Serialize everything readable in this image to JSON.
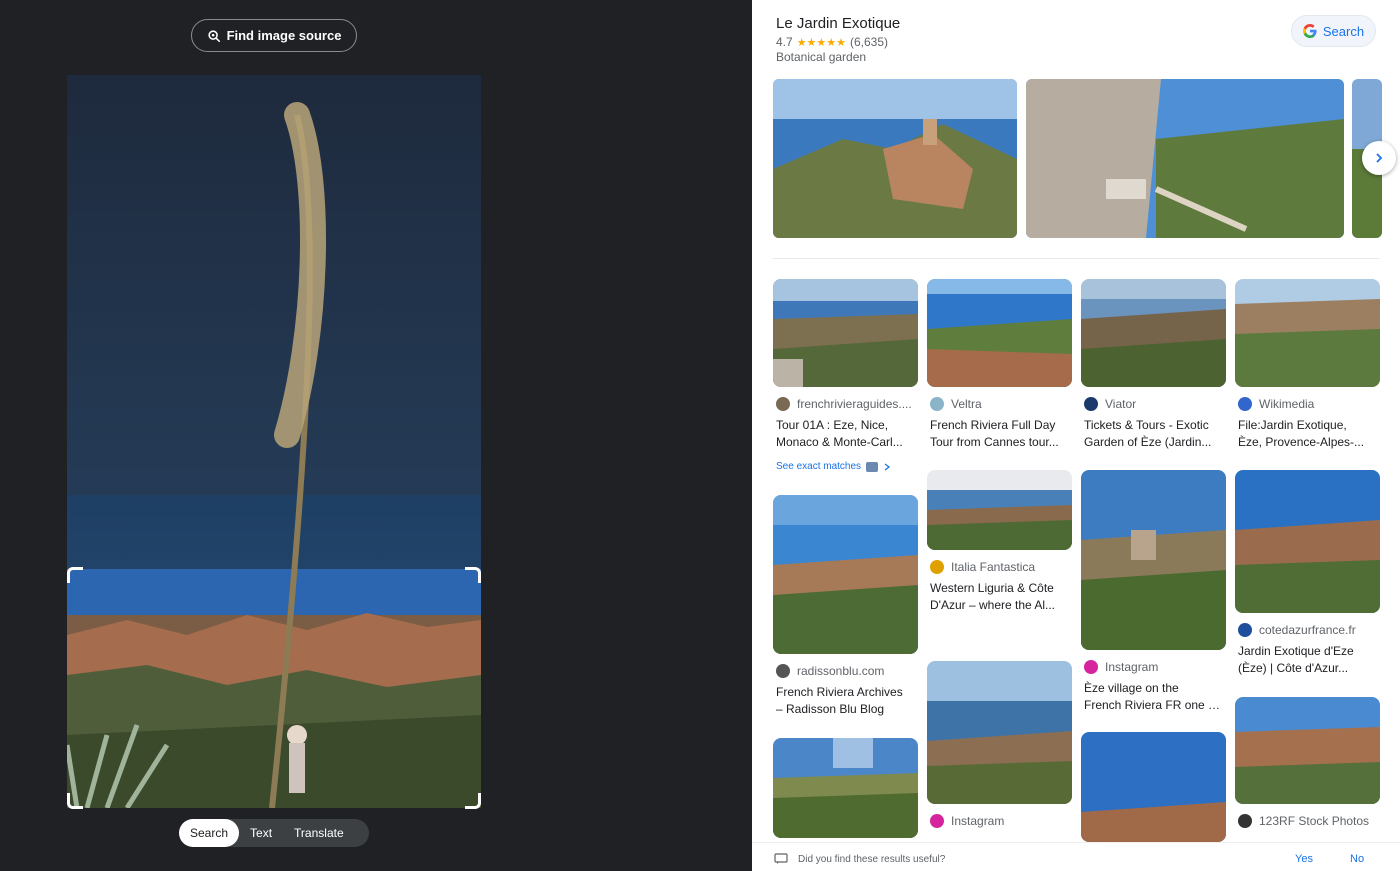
{
  "lens": {
    "find_source": "Find image source",
    "modes": [
      "Search",
      "Text",
      "Translate"
    ],
    "active_mode": "Search"
  },
  "place": {
    "name": "Le Jardin Exotique",
    "rating": "4.7",
    "reviews": "(6,635)",
    "type": "Botanical garden",
    "search_button": "Search"
  },
  "results": [
    {
      "source": "frenchrivieraguides....",
      "title1": "Tour 01A : Eze, Nice,",
      "title2": "Monaco & Monte-Carl...",
      "favicon_color": "#7a6a55"
    },
    {
      "source": "Veltra",
      "title1": "French Riviera Full Day",
      "title2": "Tour from Cannes tour...",
      "favicon_color": "#8ab4c8"
    },
    {
      "source": "Viator",
      "title1": "Tickets & Tours - Exotic",
      "title2": "Garden of Èze (Jardin...",
      "favicon_color": "#1b3a6b"
    },
    {
      "source": "Wikimedia",
      "title1": "File:Jardin Exotique,",
      "title2": "Èze, Provence-Alpes-...",
      "favicon_color": "#3366cc"
    },
    {
      "source": "radissonblu.com",
      "title1": "French Riviera Archives",
      "title2": "– Radisson Blu Blog",
      "favicon_color": "#555555"
    },
    {
      "source": "Italia Fantastica",
      "title1": "Western Liguria & Côte",
      "title2": "D'Azur – where the Al...",
      "favicon_color": "#e0a100"
    },
    {
      "source": "Instagram",
      "title1": "Èze village on the",
      "title2": "French Riviera FR one o...",
      "favicon_color": "#d6249f"
    },
    {
      "source": "cotedazurfrance.fr",
      "title1": "Jardin Exotique d'Eze",
      "title2": "(Èze) | Côte d'Azur...",
      "favicon_color": "#1f4e9c"
    },
    {
      "source": "Instagram",
      "title1": "",
      "title2": "",
      "favicon_color": "#d6249f"
    },
    {
      "source": "123RF Stock Photos",
      "title1": "",
      "title2": "",
      "favicon_color": "#333333"
    }
  ],
  "see_exact": "See exact matches",
  "feedback": {
    "question": "Did you find these results useful?",
    "yes": "Yes",
    "no": "No"
  }
}
